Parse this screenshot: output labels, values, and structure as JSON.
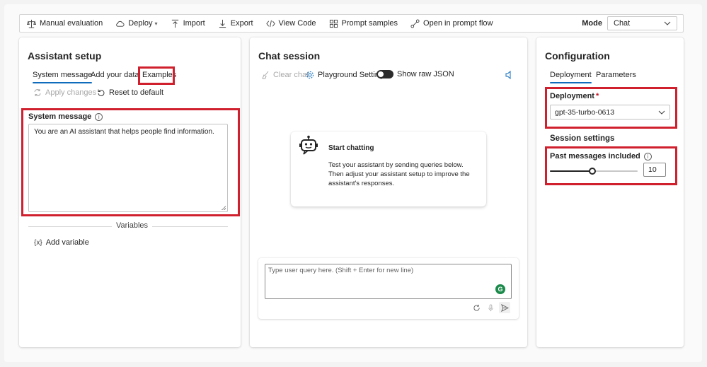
{
  "toolbar": {
    "items": [
      {
        "label": "Manual evaluation",
        "icon": "scale-icon"
      },
      {
        "label": "Deploy",
        "icon": "cloud-icon"
      },
      {
        "label": "Import",
        "icon": "import-icon"
      },
      {
        "label": "Export",
        "icon": "export-icon"
      },
      {
        "label": "View Code",
        "icon": "code-icon"
      },
      {
        "label": "Prompt samples",
        "icon": "grid-icon"
      },
      {
        "label": "Open in prompt flow",
        "icon": "flow-icon"
      }
    ],
    "mode_label": "Mode",
    "mode_value": "Chat"
  },
  "assistant_setup": {
    "title": "Assistant setup",
    "tabs": [
      "System message",
      "Add your data",
      "Examples"
    ],
    "apply_label": "Apply changes",
    "reset_label": "Reset to default",
    "system_message_label": "System message",
    "system_message_value": "You are an AI assistant that helps people find information.",
    "variables_label": "Variables",
    "add_variable_label": "Add variable"
  },
  "chat": {
    "title": "Chat session",
    "clear_label": "Clear chat",
    "playground_label": "Playground Settings",
    "raw_json_label": "Show raw JSON",
    "start_title": "Start chatting",
    "start_body": "Test your assistant by sending queries below. Then adjust your assistant setup to improve the assistant's responses.",
    "input_placeholder": "Type user query here. (Shift + Enter for new line)"
  },
  "configuration": {
    "title": "Configuration",
    "tabs": [
      "Deployment",
      "Parameters"
    ],
    "deployment_label": "Deployment",
    "required_mark": "*",
    "deployment_value": "gpt-35-turbo-0613",
    "session_title": "Session settings",
    "past_messages_label": "Past messages included",
    "past_messages_value": "10",
    "slider_fraction": 0.48
  },
  "colors": {
    "accent": "#0f6cbd",
    "highlight": "#d0202e"
  }
}
